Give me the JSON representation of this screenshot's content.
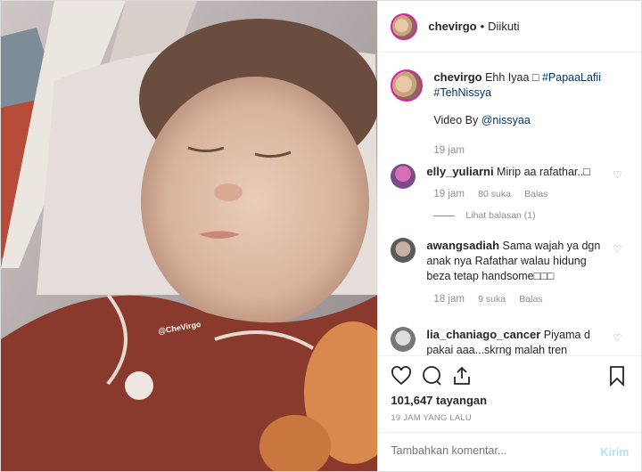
{
  "header": {
    "username": "chevirgo",
    "separator": "•",
    "follow_status": "Diikuti"
  },
  "caption": {
    "username": "chevirgo",
    "text": "Ehh Iyaa",
    "emoji": "□",
    "hashtag1": "#PapaaLafii",
    "hashtag2": "#TehNissya",
    "credit_prefix": "Video By",
    "credit_mention": "@nissyaa",
    "time": "19 jam"
  },
  "comments": [
    {
      "username": "elly_yuliarni",
      "text": "Mirip aa rafathar..□",
      "time": "19 jam",
      "likes": "80 suka",
      "reply": "Balas",
      "view_replies": "Lihat balasan (1)"
    },
    {
      "username": "awangsadiah",
      "text": "Sama wajah ya dgn anak nya Rafathar walau hidung beza tetap handsome□□□",
      "time": "18 jam",
      "likes": "9 suka",
      "reply": "Balas"
    },
    {
      "username": "lia_chaniago_cancer",
      "text": "Piyama d pakai aaa...skrng malah tren"
    }
  ],
  "media": {
    "watermark": "@CheVirgo"
  },
  "stats": {
    "views": "101,647 tayangan",
    "posted": "19 JAM YANG LALU"
  },
  "composer": {
    "placeholder": "Tambahkan komentar...",
    "submit": "Kirim"
  }
}
